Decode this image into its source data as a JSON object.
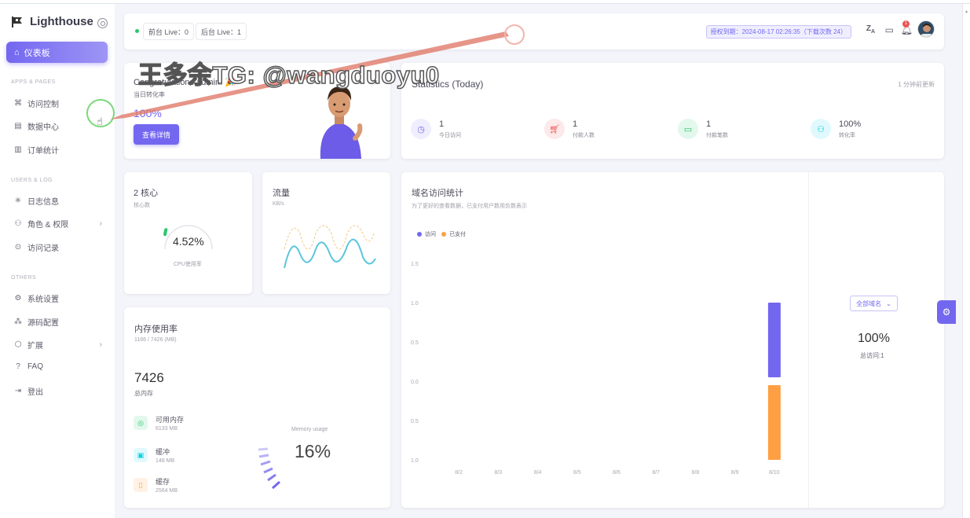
{
  "app": {
    "name": "Lighthouse"
  },
  "sidebar": {
    "active": {
      "label": "仪表板",
      "icon": "home-icon"
    },
    "sections": [
      {
        "title": "APPS & PAGES"
      },
      {
        "title": "USERS & LOG"
      },
      {
        "title": "OTHERS"
      }
    ],
    "items": [
      {
        "label": "访问控制",
        "icon": "command-icon"
      },
      {
        "label": "数据中心",
        "icon": "database-icon"
      },
      {
        "label": "订单统计",
        "icon": "bar-chart-icon"
      },
      {
        "label": "日志信息",
        "icon": "loader-icon"
      },
      {
        "label": "角色 & 权限",
        "icon": "users-icon"
      },
      {
        "label": "访问记录",
        "icon": "shield-icon"
      },
      {
        "label": "系统设置",
        "icon": "settings-icon"
      },
      {
        "label": "源码配置",
        "icon": "grid-icon"
      },
      {
        "label": "扩展",
        "icon": "package-icon"
      },
      {
        "label": "FAQ",
        "icon": "help-circle-icon"
      },
      {
        "label": "登出",
        "icon": "logout-icon"
      }
    ]
  },
  "topbar": {
    "front_live": "前台 Live：0",
    "back_live": "后台 Live：1",
    "license": "授权到期：2024-08-17 02:26:35（下载次数 24）",
    "icons": [
      "translate-icon",
      "monitor-icon",
      "bell-icon"
    ],
    "bell_badge": "1"
  },
  "congrats": {
    "title": "Congratulations admin! 🎉",
    "subtitle": "当日转化率",
    "value": "100%",
    "button": "查看详情"
  },
  "watermark": "王多余TG: @wangduoyu0",
  "stats": {
    "title": "Statistics (Today)",
    "updated": "1 分钟前更新",
    "items": [
      {
        "value": "1",
        "label": "今日访问",
        "icon": "clock-icon",
        "color": "#7367f0",
        "bg": "#efeefe"
      },
      {
        "value": "1",
        "label": "付款人数",
        "icon": "cart-icon",
        "color": "#ea5455",
        "bg": "#fce9e9"
      },
      {
        "value": "1",
        "label": "付款笔数",
        "icon": "card-icon",
        "color": "#28c76f",
        "bg": "#e3f8ec"
      },
      {
        "value": "100%",
        "label": "转化率",
        "icon": "user-icon",
        "color": "#00cfe8",
        "bg": "#e0f9fc"
      }
    ]
  },
  "cpu": {
    "title": "2 核心",
    "subtitle": "核心数",
    "value": "4.52%",
    "caption": "CPU使用率",
    "fraction": 0.0452
  },
  "traffic": {
    "title": "流量",
    "subtitle": "KB/s"
  },
  "memory": {
    "title": "内存使用率",
    "subtitle": "1166 / 7426 (MB)",
    "total": "7426",
    "total_label": "总内存",
    "usage_label": "Memory usage",
    "usage_value": "16%",
    "items": [
      {
        "label": "可用内存",
        "sub": "6133 MB",
        "icon": "check-circle-icon",
        "color": "#28c76f",
        "bg": "#e3f8ec"
      },
      {
        "label": "缓冲",
        "sub": "148 MB",
        "icon": "layers-icon",
        "color": "#00cfe8",
        "bg": "#e0f9fc"
      },
      {
        "label": "缓存",
        "sub": "2564 MB",
        "icon": "file-icon",
        "color": "#ff9f43",
        "bg": "#fff1e3"
      }
    ]
  },
  "domain": {
    "title": "域名访问统计",
    "subtitle": "为了更好的查看数据，已支付用户数用负数表示",
    "filter": "全部域名",
    "summary_value": "100%",
    "summary_label": "总访问:1"
  },
  "chart_data": {
    "type": "bar",
    "title": "域名访问统计",
    "categories": [
      "8/2",
      "8/3",
      "8/4",
      "8/5",
      "8/6",
      "8/7",
      "8/8",
      "8/9",
      "8/10"
    ],
    "series": [
      {
        "name": "访问",
        "color": "#7367f0",
        "values": [
          0,
          0,
          0,
          0,
          0,
          0,
          0,
          0,
          1
        ]
      },
      {
        "name": "已支付",
        "color": "#ff9f43",
        "values": [
          0,
          0,
          0,
          0,
          0,
          0,
          0,
          0,
          -1
        ]
      }
    ],
    "ytick_labels": [
      "1.5",
      "1.0",
      "0.5",
      "0.0",
      "0.5",
      "1.0"
    ],
    "ylim": [
      -1,
      1.5
    ],
    "legend": "top-left"
  },
  "colors": {
    "accent": "#7367f0",
    "success": "#28c76f",
    "danger": "#ea5455",
    "warning": "#ff9f43",
    "info": "#00cfe8"
  }
}
